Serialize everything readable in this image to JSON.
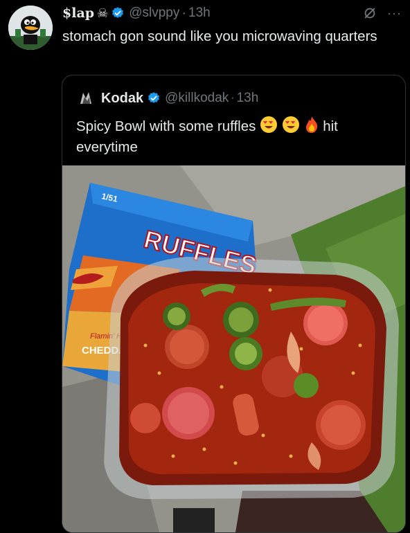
{
  "tweet": {
    "display_name": "$lap",
    "name_icon": "skull-icon",
    "handle": "@slvppy",
    "time": "13h",
    "text": "stomach gon sound like you microwaving quarters",
    "avatar_icon": "daffy-duck-avatar"
  },
  "quote": {
    "display_name": "Kodak",
    "handle": "@killkodak",
    "time": "13h",
    "text_before": "Spicy Bowl with some ruffles",
    "text_after": "hit everytime",
    "emojis": [
      "heart-eyes-emoji",
      "heart-eyes-emoji",
      "fire-emoji"
    ],
    "media": {
      "bag_brand": "RUFFLES",
      "bag_flavor": "CHEDDA",
      "bag_subtext": "Flamin' Hot",
      "bag_badge": "1/51"
    }
  },
  "colors": {
    "background": "#000000",
    "text": "#e7e9ea",
    "muted": "#71767b",
    "verified": "#1d9bf0",
    "border": "#2f3336"
  }
}
